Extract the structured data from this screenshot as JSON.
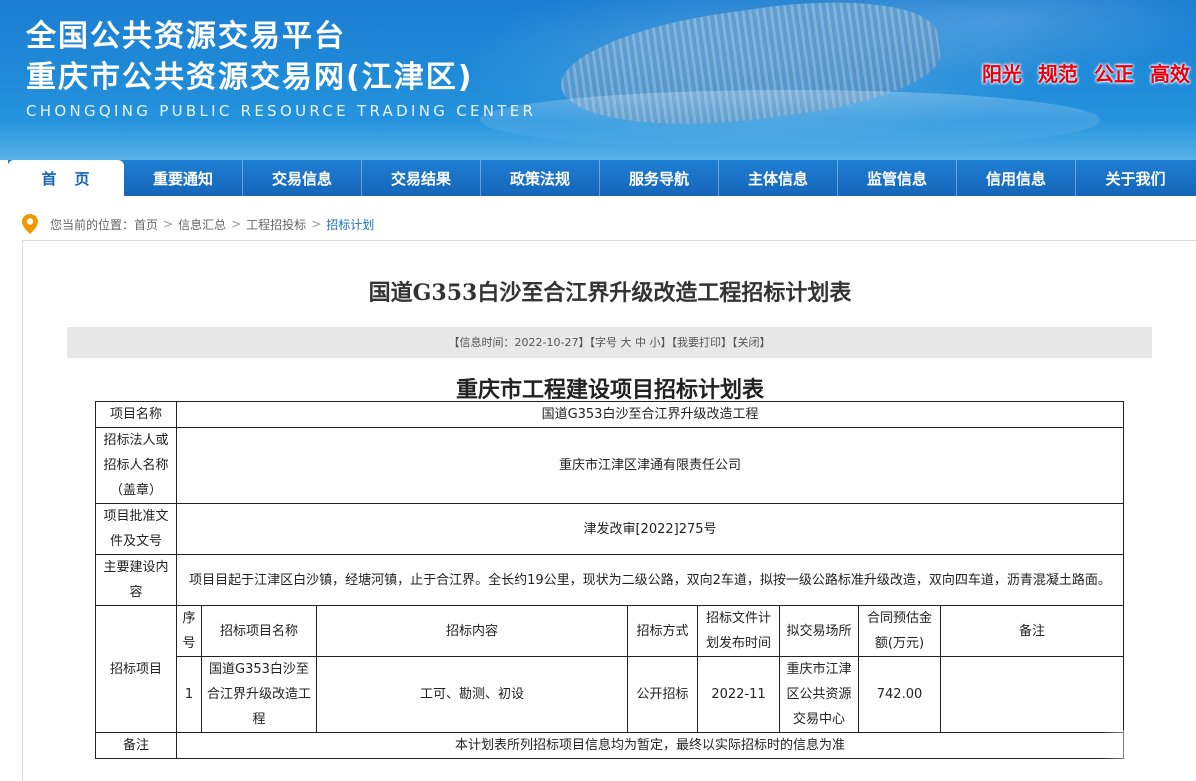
{
  "header": {
    "title_line1": "全国公共资源交易平台",
    "title_line2": "重庆市公共资源交易网(江津区)",
    "title_en": "CHONGQING PUBLIC RESOURCE TRADING CENTER",
    "slogans": [
      "阳光",
      "规范",
      "公正",
      "高效"
    ]
  },
  "nav": {
    "items": [
      "首页",
      "重要通知",
      "交易信息",
      "交易结果",
      "政策法规",
      "服务导航",
      "主体信息",
      "监管信息",
      "信用信息",
      "关于我们"
    ]
  },
  "breadcrumb": {
    "prefix": "您当前的位置：",
    "items": [
      "首页",
      "信息汇总",
      "工程招投标",
      "招标计划"
    ],
    "separator": ">"
  },
  "article": {
    "title": "国道G353白沙至合江界升级改造工程招标计划表",
    "info_time": "【信息时间：2022-10-27】",
    "font_label": "【字号",
    "font_large": "大",
    "font_medium": "中",
    "font_small": "小】",
    "print": "【我要打印】",
    "close": "【关闭】",
    "sub_title": "重庆市工程建设项目招标计划表"
  },
  "table": {
    "project_name_label": "项目名称",
    "project_name": "国道G353白沙至合江界升级改造工程",
    "tenderer_label": "招标法人或招标人名称（盖章）",
    "tenderer": "重庆市江津区津通有限责任公司",
    "approval_label": "项目批准文件及文号",
    "approval": "津发改审[2022]275号",
    "content_label": "主要建设内容",
    "content": "项目目起于江津区白沙镇，经塘河镇，止于合江界。全长约19公里，现状为二级公路，双向2车道，拟按一级公路标准升级改造，双向四车道，沥青混凝土路面。",
    "bid_label": "招标项目",
    "columns": [
      "序号",
      "招标项目名称",
      "招标内容",
      "招标方式",
      "招标文件计划发布时间",
      "拟交易场所",
      "合同预估金额(万元)",
      "备注"
    ],
    "rows": [
      {
        "no": "1",
        "name": "国道G353白沙至合江界升级改造工程",
        "content": "工可、勘测、初设",
        "method": "公开招标",
        "time": "2022-11",
        "place": "重庆市江津区公共资源交易中心",
        "amount": "742.00",
        "remark": ""
      }
    ],
    "note_label": "备注",
    "note": "本计划表所列招标项目信息均为暂定，最终以实际招标时的信息为准"
  }
}
